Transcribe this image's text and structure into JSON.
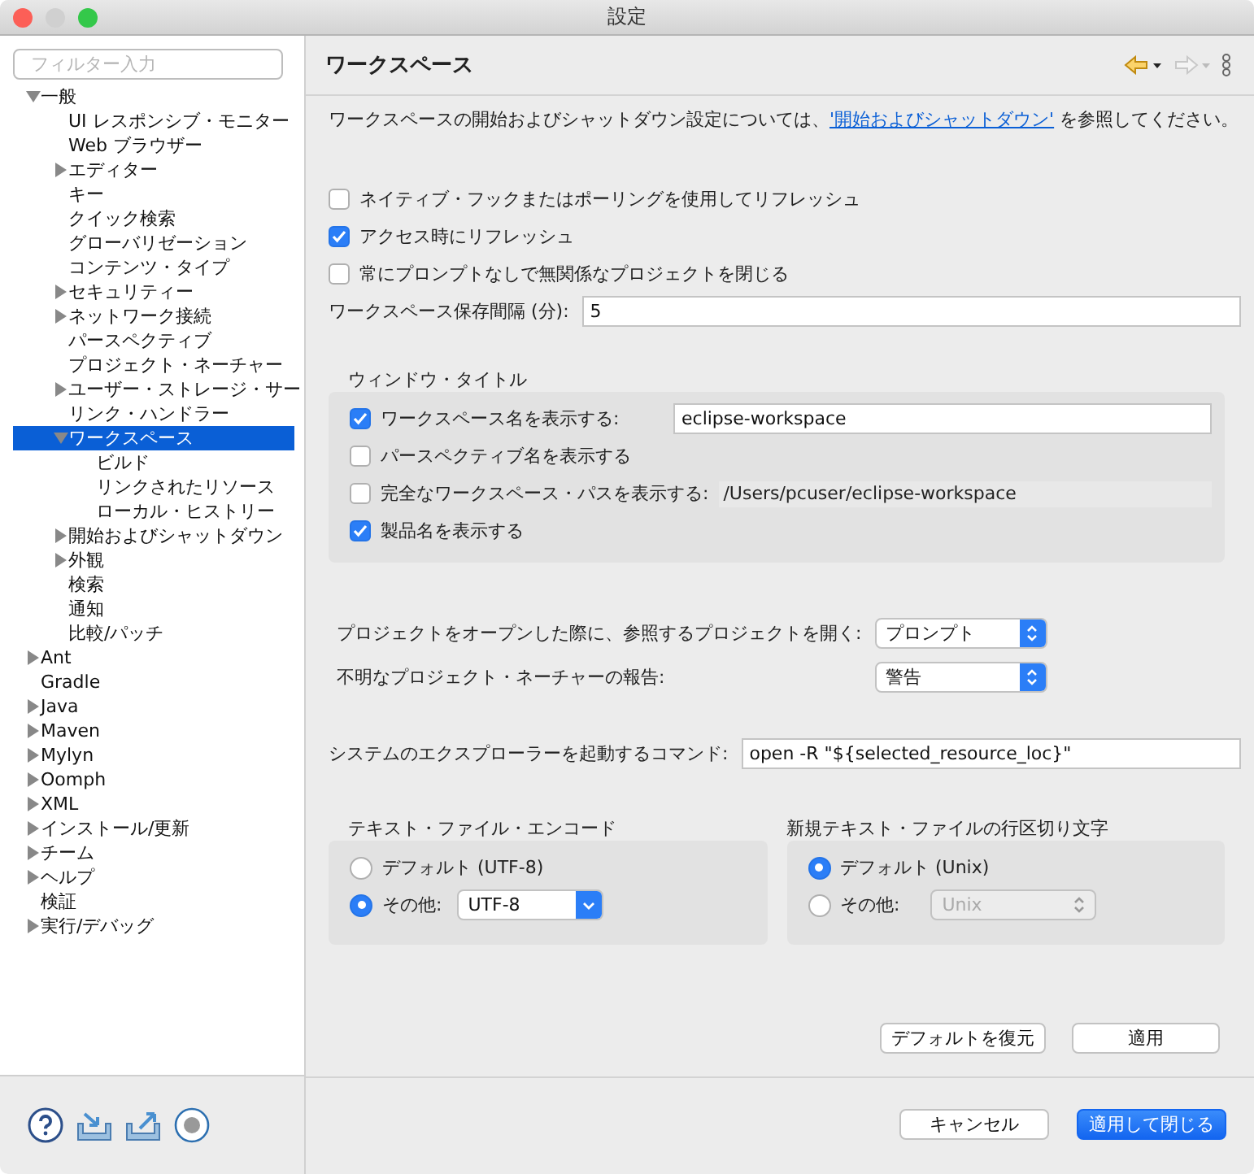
{
  "window": {
    "title": "設定"
  },
  "filter": {
    "placeholder": "フィルター入力"
  },
  "tree": [
    {
      "label": "一般",
      "expanded": true,
      "selected": false,
      "children": [
        {
          "label": "UI レスポンシブ・モニター",
          "selected": false
        },
        {
          "label": "Web ブラウザー",
          "selected": false
        },
        {
          "label": "エディター",
          "expanded": false,
          "selected": false
        },
        {
          "label": "キー",
          "selected": false
        },
        {
          "label": "クイック検索",
          "selected": false
        },
        {
          "label": "グローバリゼーション",
          "selected": false
        },
        {
          "label": "コンテンツ・タイプ",
          "selected": false
        },
        {
          "label": "セキュリティー",
          "expanded": false,
          "selected": false
        },
        {
          "label": "ネットワーク接続",
          "expanded": false,
          "selected": false
        },
        {
          "label": "パースペクティブ",
          "selected": false
        },
        {
          "label": "プロジェクト・ネーチャー",
          "selected": false
        },
        {
          "label": "ユーザー・ストレージ・サー",
          "expanded": false,
          "selected": false
        },
        {
          "label": "リンク・ハンドラー",
          "selected": false
        },
        {
          "label": "ワークスペース",
          "expanded": true,
          "selected": true,
          "children": [
            {
              "label": "ビルド",
              "selected": false
            },
            {
              "label": "リンクされたリソース",
              "selected": false
            },
            {
              "label": "ローカル・ヒストリー",
              "selected": false
            }
          ]
        },
        {
          "label": "開始およびシャットダウン",
          "expanded": false,
          "selected": false
        },
        {
          "label": "外観",
          "expanded": false,
          "selected": false
        },
        {
          "label": "検索",
          "selected": false
        },
        {
          "label": "通知",
          "selected": false
        },
        {
          "label": "比較/パッチ",
          "selected": false
        }
      ]
    },
    {
      "label": "Ant",
      "expanded": false,
      "selected": false
    },
    {
      "label": "Gradle",
      "selected": false
    },
    {
      "label": "Java",
      "expanded": false,
      "selected": false
    },
    {
      "label": "Maven",
      "expanded": false,
      "selected": false
    },
    {
      "label": "Mylyn",
      "expanded": false,
      "selected": false
    },
    {
      "label": "Oomph",
      "expanded": false,
      "selected": false
    },
    {
      "label": "XML",
      "expanded": false,
      "selected": false
    },
    {
      "label": "インストール/更新",
      "expanded": false,
      "selected": false
    },
    {
      "label": "チーム",
      "expanded": false,
      "selected": false
    },
    {
      "label": "ヘルプ",
      "expanded": false,
      "selected": false
    },
    {
      "label": "検証",
      "selected": false
    },
    {
      "label": "実行/デバッグ",
      "expanded": false,
      "selected": false
    }
  ],
  "page": {
    "title": "ワークスペース",
    "description": {
      "before": "ワークスペースの開始およびシャットダウン設定については、",
      "link": "'開始およびシャットダウン'",
      "after": " を参照してください。"
    },
    "checkboxes": [
      {
        "label": "ネイティブ・フックまたはポーリングを使用してリフレッシュ",
        "checked": false
      },
      {
        "label": "アクセス時にリフレッシュ",
        "checked": true
      },
      {
        "label": "常にプロンプトなしで無関係なプロジェクトを閉じる",
        "checked": false
      }
    ],
    "save_interval": {
      "label": "ワークスペース保存間隔 (分):",
      "value": "5"
    },
    "window_title": {
      "title": "ウィンドウ・タイトル",
      "options": [
        {
          "kind": "input",
          "label": "ワークスペース名を表示する:",
          "checked": true,
          "value": "eclipse-workspace"
        },
        {
          "kind": "plain",
          "label": "パースペクティブ名を表示する",
          "checked": false
        },
        {
          "kind": "readonly",
          "label": "完全なワークスペース・パスを表示する:",
          "checked": false,
          "value": "/Users/pcuser/eclipse-workspace"
        },
        {
          "kind": "plain",
          "label": "製品名を表示する",
          "checked": true
        }
      ]
    },
    "selects": [
      {
        "label": "プロジェクトをオープンした際に、参照するプロジェクトを開く:",
        "value": "プロンプト"
      },
      {
        "label": "不明なプロジェクト・ネーチャーの報告:",
        "value": "警告"
      }
    ],
    "explorer_command": {
      "label": "システムのエクスプローラーを起動するコマンド:",
      "value": "open -R \"${selected_resource_loc}\""
    },
    "groups": [
      {
        "title": "テキスト・ファイル・エンコード",
        "default_label": "デフォルト (UTF-8)",
        "default_selected": false,
        "other_label": "その他:",
        "other_selected": true,
        "other_value": "UTF-8"
      },
      {
        "title": "新規テキスト・ファイルの行区切り文字",
        "default_label": "デフォルト (Unix)",
        "default_selected": true,
        "other_label": "その他:",
        "other_selected": false,
        "other_value": "Unix"
      }
    ],
    "page_buttons": [
      "デフォルトを復元",
      "適用"
    ]
  },
  "footer_buttons": [
    {
      "label": "キャンセル",
      "primary": false
    },
    {
      "label": "適用して閉じる",
      "primary": true
    }
  ]
}
